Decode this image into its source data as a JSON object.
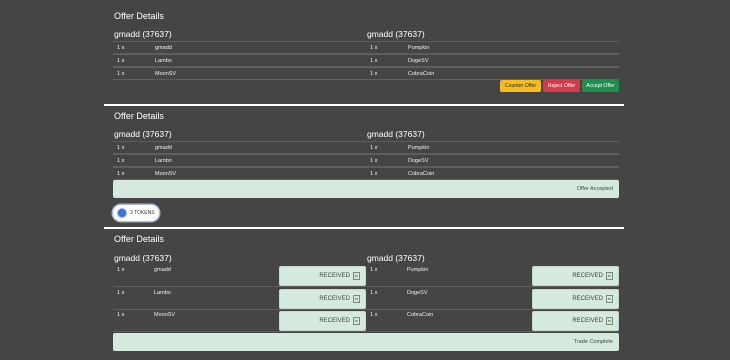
{
  "offers": [
    {
      "title": "Offer Details",
      "left_user": "gmadd (37637)",
      "right_user": "gmadd (37637)",
      "left_items": [
        {
          "qty": "1 x",
          "name": "gmadd"
        },
        {
          "qty": "1 x",
          "name": "Lambo"
        },
        {
          "qty": "1 x",
          "name": "MoonSV"
        }
      ],
      "right_items": [
        {
          "qty": "1 x",
          "name": "Pumpkin"
        },
        {
          "qty": "1 x",
          "name": "DogeSV"
        },
        {
          "qty": "1 x",
          "name": "CobraCoin"
        }
      ],
      "buttons": {
        "counter": "Counter Offer",
        "reject": "Reject Offer",
        "accept": "Accept Offer"
      }
    },
    {
      "title": "Offer Details",
      "left_user": "gmadd (37637)",
      "right_user": "gmadd (37637)",
      "left_items": [
        {
          "qty": "1 x",
          "name": "gmadd"
        },
        {
          "qty": "1 x",
          "name": "Lambo"
        },
        {
          "qty": "1 x",
          "name": "MoonSV"
        }
      ],
      "right_items": [
        {
          "qty": "1 x",
          "name": "Pumpkin"
        },
        {
          "qty": "1 x",
          "name": "DogeSV"
        },
        {
          "qty": "1 x",
          "name": "CobraCoin"
        }
      ],
      "status": "Offer Accepted",
      "token_badge": "3 TOKENS"
    },
    {
      "title": "Offer Details",
      "left_user": "gmadd (37637)",
      "right_user": "gmadd (37637)",
      "left_items": [
        {
          "qty": "1 x",
          "name": "gmadd",
          "received": "RECEIVED",
          "tx": "tx"
        },
        {
          "qty": "1 x",
          "name": "Lambo",
          "received": "RECEIVED",
          "tx": "tx"
        },
        {
          "qty": "1 x",
          "name": "MoonSV",
          "received": "RECEIVED",
          "tx": "tx"
        }
      ],
      "right_items": [
        {
          "qty": "1 x",
          "name": "Pumpkin",
          "received": "RECEIVED",
          "tx": "tx"
        },
        {
          "qty": "1 x",
          "name": "DogeSV",
          "received": "RECEIVED",
          "tx": "tx"
        },
        {
          "qty": "1 x",
          "name": "CobraCoin",
          "received": "RECEIVED",
          "tx": "tx"
        }
      ],
      "status": "Trade Complete"
    }
  ],
  "colors": {
    "background": "#454545",
    "counter": "#f2bd1e",
    "reject": "#d8394a",
    "accept": "#1f8f4f",
    "status_bg": "#d6e9df",
    "token_dot": "#3c70e0"
  }
}
